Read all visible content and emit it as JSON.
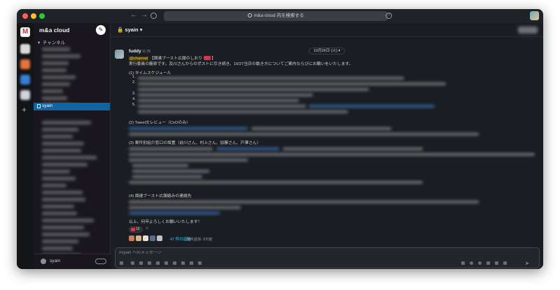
{
  "window": {
    "search_placeholder": "m&a cloud 内を検索する"
  },
  "workspace": {
    "name": "m&a cloud",
    "section_label": "チャンネル",
    "active_channel": "syain"
  },
  "channel": {
    "title": "syain"
  },
  "message": {
    "date_divider": "10月26日 (火)",
    "author": "fuddy",
    "time": "11:25",
    "mention": "@channel",
    "title_text": "【調達ブースト広報のしおり",
    "intro": "実行委員の藤原です。及川さんからのポストに引き続き、10/27当日の動き方についてご案内ならびにお願いをいたします。",
    "sections": [
      {
        "heading": "(1) タイムスケジュール"
      },
      {
        "heading": "(2) Tweet文レビュー（CxOのみ）"
      },
      {
        "heading": "(3) 案件別紹介窓口の設置（前川さん、村上さん、加藤さん、戸澤さん）"
      },
      {
        "heading": "(4) 調達ブースト広報絡みの連絡先"
      }
    ],
    "list_numbers": [
      "1.",
      "2.",
      "3.",
      "4.",
      "5."
    ],
    "closing": "以上、何卒よろしくお願いいたします！",
    "reaction_count": "16",
    "replies": "47 件の返信",
    "last_reply": "最終返信: 9日前"
  },
  "composer": {
    "placeholder": "#syain へのメッセージ"
  },
  "footer": {
    "label": "syain"
  },
  "colors": {
    "accent": "#1164a3",
    "mention_fg": "#f1c44f",
    "link": "#1d9bd1"
  }
}
